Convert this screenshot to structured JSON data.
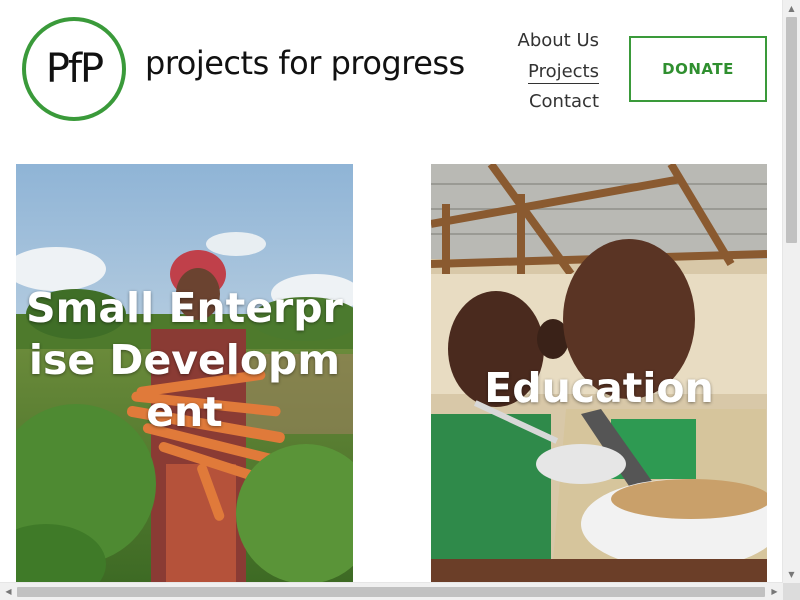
{
  "header": {
    "logo_text": "PfP",
    "site_name": "projects for progress"
  },
  "nav": {
    "items": [
      {
        "label": "About Us"
      },
      {
        "label": "Projects"
      },
      {
        "label": "Contact"
      }
    ],
    "donate_label": "DONATE"
  },
  "cards": [
    {
      "title": "Small Enterprise Development"
    },
    {
      "title": "Education"
    }
  ],
  "colors": {
    "brand_green": "#3a9a3a",
    "text": "#111111"
  }
}
